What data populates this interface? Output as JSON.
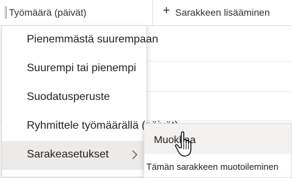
{
  "header": {
    "column_label": "Työmäärä (päivät)",
    "add_column_label": "Sarakkeen lisääminen",
    "add_icon": "plus-icon",
    "grip_icon": "column-grip-icon"
  },
  "menu": {
    "items": [
      {
        "label": "Pienemmästä suurempaan"
      },
      {
        "label": "Suurempi tai pienempi"
      },
      {
        "label": "Suodatusperuste"
      },
      {
        "label": "Ryhmittele työmäärällä (päivät)"
      },
      {
        "label": "Sarakeasetukset",
        "has_submenu": true,
        "submenu_icon": "chevron-right-icon"
      }
    ]
  },
  "submenu": {
    "items": [
      {
        "label": "Muokkaa"
      },
      {
        "label": "Tämän sarakkeen muotoileminen"
      }
    ]
  },
  "cursor_icon": "hand-pointer-icon",
  "colors": {
    "menu_hover": "#edebe9",
    "border": "#e1dfdd",
    "text": "#201f1e"
  }
}
